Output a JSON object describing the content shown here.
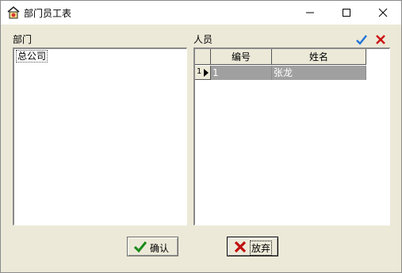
{
  "window": {
    "title": "部门员工表"
  },
  "left_panel": {
    "label": "部门",
    "tree": {
      "items": [
        {
          "label": "总公司"
        }
      ]
    }
  },
  "right_panel": {
    "label": "人员",
    "toolbar": {
      "confirm_icon": "check-icon",
      "cancel_icon": "x-icon"
    },
    "grid": {
      "columns": [
        "编号",
        "姓名"
      ],
      "rows": [
        {
          "row_number": "1",
          "cells": [
            "1",
            "张龙"
          ]
        }
      ]
    }
  },
  "buttons": {
    "ok_label": "确认",
    "cancel_label": "放弃"
  },
  "colors": {
    "check": "#1e73d8",
    "x": "#cc1111",
    "selected_row": "#a0a0a0"
  }
}
